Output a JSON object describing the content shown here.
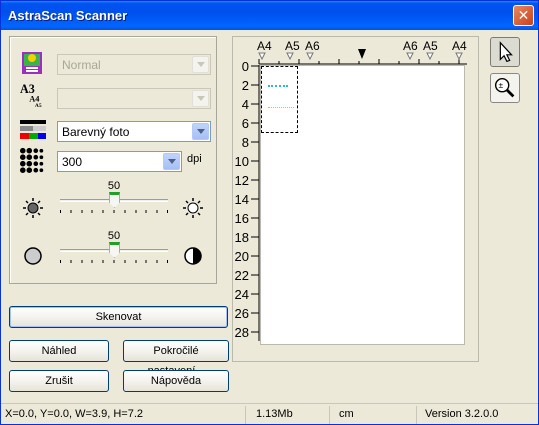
{
  "window": {
    "title": "AstraScan Scanner",
    "close_symbol": "✕"
  },
  "settings": {
    "mode": {
      "icon": "document-type-icon",
      "value": "Normal",
      "enabled": false
    },
    "paper_size": {
      "icon": "paper-size-icon",
      "value": "",
      "enabled": false
    },
    "color_mode": {
      "icon": "color-mode-icon",
      "value": "Barevný foto",
      "enabled": true
    },
    "resolution": {
      "icon": "resolution-icon",
      "value": "300",
      "unit": "dpi",
      "enabled": true
    },
    "brightness": {
      "icon_low": "brightness-low-icon",
      "icon_high": "brightness-high-icon",
      "value": "50",
      "level": 0.5
    },
    "contrast": {
      "icon_low": "contrast-low-icon",
      "icon_high": "contrast-high-icon",
      "value": "50",
      "level": 0.5
    }
  },
  "buttons": {
    "scan": "Skenovat",
    "preview": "Náhled",
    "advanced": "Pokročilé nastavení...",
    "cancel": "Zrušit",
    "help": "Nápověda"
  },
  "ruler": {
    "top_left_marks": [
      "A4",
      "A5",
      "A6"
    ],
    "top_right_marks": [
      "A6",
      "A5",
      "A4"
    ],
    "y_labels": [
      "0",
      "2",
      "4",
      "6",
      "8",
      "10",
      "12",
      "14",
      "16",
      "18",
      "20",
      "22",
      "24",
      "26",
      "28"
    ]
  },
  "tools": {
    "select": "pointer-icon",
    "zoom": "zoom-icon"
  },
  "status": {
    "selection": "X=0.0, Y=0.0, W=3.9, H=7.2",
    "size": "1.13Mb",
    "unit": "cm",
    "version": "Version 3.2.0.0"
  }
}
